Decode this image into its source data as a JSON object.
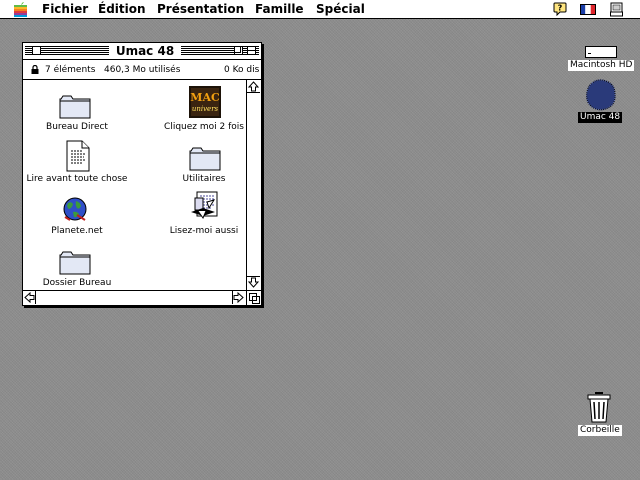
{
  "menubar": {
    "items": [
      "Fichier",
      "Édition",
      "Présentation",
      "Famille",
      "Spécial"
    ]
  },
  "window": {
    "title": "Umac 48",
    "info": {
      "count": "7 éléments",
      "used": "460,3 Mo utilisés",
      "free": "0  Ko dis"
    },
    "items": [
      {
        "label": "Bureau Direct",
        "icon": "folder-icon"
      },
      {
        "label": "Cliquez moi 2 fois",
        "icon": "mac-univers-icon"
      },
      {
        "label": "Lire avant toute chose",
        "icon": "document-icon"
      },
      {
        "label": "Utilitaires",
        "icon": "folder-icon"
      },
      {
        "label": "Planete.net",
        "icon": "globe-icon"
      },
      {
        "label": "Lisez-moi aussi",
        "icon": "readme-icon"
      },
      {
        "label": "Dossier Bureau",
        "icon": "folder-icon"
      }
    ]
  },
  "desktop": {
    "volumes": [
      {
        "label": "Macintosh HD",
        "icon": "hard-disk-icon",
        "selected": false
      },
      {
        "label": "Umac 48",
        "icon": "disk-icon",
        "selected": true
      }
    ],
    "trash": {
      "label": "Corbeille",
      "icon": "trash-icon"
    }
  },
  "logo_text": "MAC univers"
}
